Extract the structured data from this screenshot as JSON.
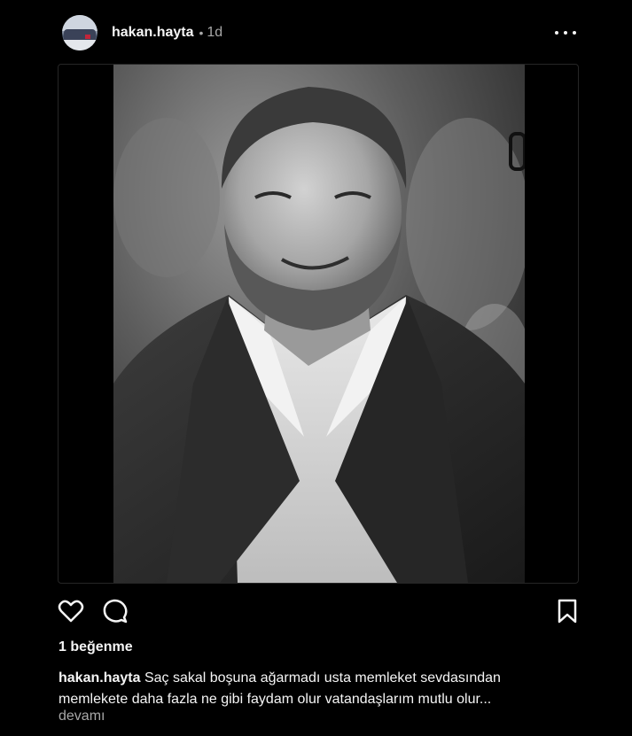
{
  "post": {
    "username": "hakan.hayta",
    "separator": "•",
    "time": "1d",
    "likes": "1 beğenme",
    "caption": "Saç sakal boşuna ağarmadı usta memleket sevdasından memlekete daha fazla ne gibi faydam olur vatandaşlarım mutlu olur...",
    "more_label": "devamı"
  },
  "icons": {
    "avatar": "avatar-image",
    "more": "more-options-icon",
    "like": "heart-icon",
    "comment": "comment-bubble-icon",
    "save": "bookmark-icon",
    "photo": "black-and-white-portrait"
  },
  "colors": {
    "background": "#000000",
    "text": "#f5f5f5",
    "secondary_text": "#a8a8a8",
    "border": "#262626"
  }
}
